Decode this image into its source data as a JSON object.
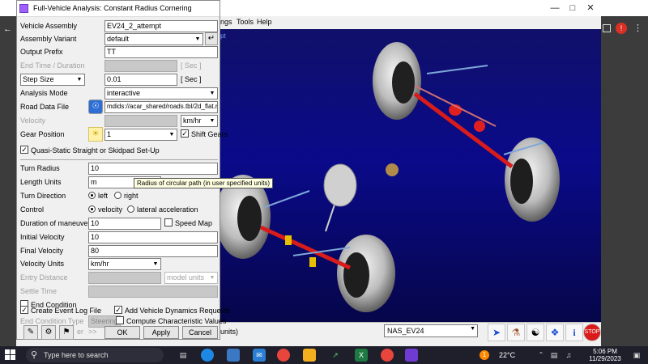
{
  "dialog": {
    "title": "Full-Vehicle Analysis: Constant Radius Cornering",
    "vehicle_assembly": {
      "label": "Vehicle Assembly",
      "value": "EV24_2_attempt"
    },
    "assembly_variant": {
      "label": "Assembly Variant",
      "value": "default"
    },
    "output_prefix": {
      "label": "Output Prefix",
      "value": "TT"
    },
    "end_time": {
      "label": "End Time / Duration",
      "unit": "[ Sec ]"
    },
    "step_size": {
      "label": "Step Size",
      "value": "0.01",
      "unit": "[ Sec ]"
    },
    "analysis_mode": {
      "label": "Analysis Mode",
      "value": "interactive"
    },
    "road_data_file": {
      "label": "Road Data File",
      "value": "mdids://acar_shared/roads.tbl/2d_flat.rdf"
    },
    "velocity": {
      "label": "Velocity",
      "unit": "km/hr"
    },
    "gear_position": {
      "label": "Gear Position",
      "value": "1",
      "shift_gears": "Shift Gears"
    },
    "quasi_static": "Quasi-Static Straight or Skidpad Set-Up",
    "turn_radius": {
      "label": "Turn Radius",
      "value": "10"
    },
    "length_units": {
      "label": "Length Units",
      "value": "m"
    },
    "turn_direction": {
      "label": "Turn Direction",
      "left": "left",
      "right": "right"
    },
    "control": {
      "label": "Control",
      "velocity": "velocity",
      "lateral": "lateral acceleration"
    },
    "duration_of_maneuver": {
      "label": "Duration of maneuver",
      "value": "10",
      "speed_map": "Speed Map"
    },
    "initial_velocity": {
      "label": "Initial Velocity",
      "value": "10"
    },
    "final_velocity": {
      "label": "Final Velocity",
      "value": "80"
    },
    "velocity_units": {
      "label": "Velocity Units",
      "value": "km/hr"
    },
    "entry_distance": {
      "label": "Entry Distance",
      "unit": "model units"
    },
    "settle_time": {
      "label": "Settle Time"
    },
    "end_condition": "End Condition",
    "create_event_log": "Create Event Log File",
    "add_vehicle_dynamics": "Add Vehicle Dynamics Requests",
    "end_condition_type": {
      "label": "End Condition Type",
      "value": "Steering"
    },
    "compute_characteristic": "Compute Characteristic Values",
    "filter_label": "er",
    "more": ">>",
    "ok": "OK",
    "apply": "Apply",
    "cancel": "Cancel",
    "tooltip": "Radius of circular path (in user specified units)"
  },
  "background_app": {
    "menu_partial": "ngs",
    "menu_tools": "Tools",
    "menu_help": "Help",
    "viewport_hint": "pt",
    "units_text": "units)",
    "model_select": "NAS_EV24"
  },
  "taskbar": {
    "search_placeholder": "Type here to search",
    "temperature": "22°C",
    "time": "5:06 PM",
    "date": "11/29/2023",
    "notification_badge": "1"
  }
}
